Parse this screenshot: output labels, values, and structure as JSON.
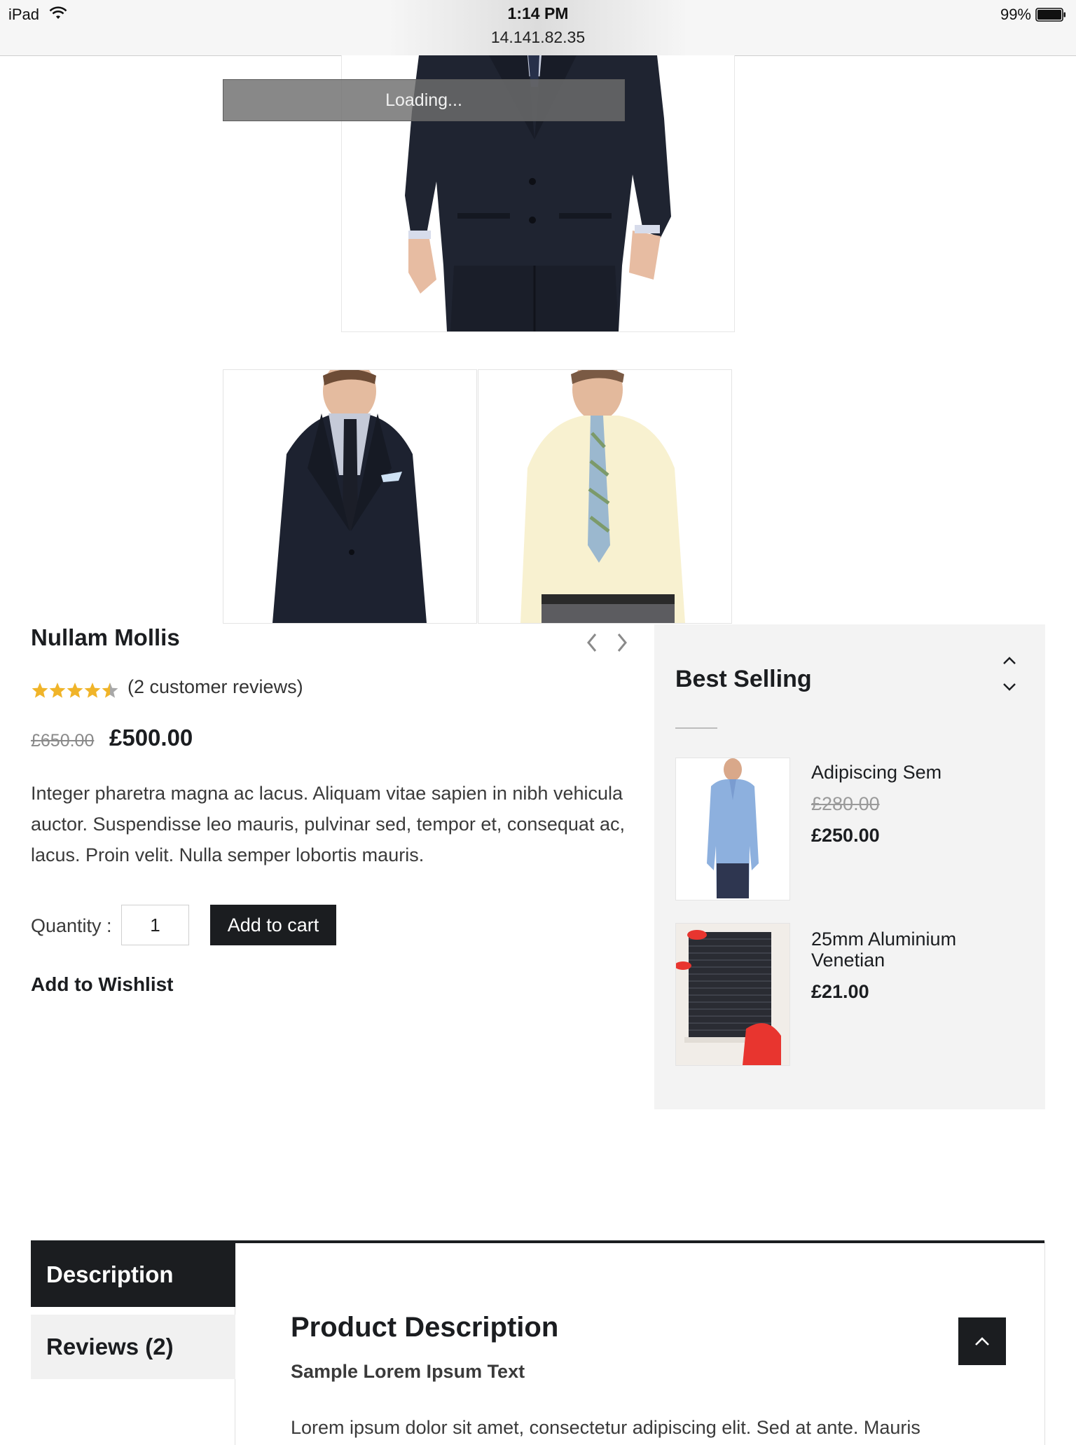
{
  "status_bar": {
    "device": "iPad",
    "time": "1:14 PM",
    "url": "14.141.82.35",
    "battery": "99%"
  },
  "product": {
    "loading_text": "Loading...",
    "title": "Nullam Mollis",
    "rating": 4.5,
    "rating_max": 5,
    "review_count_text": "(2 customer reviews)",
    "old_price": "£650.00",
    "price": "£500.00",
    "description": "Integer pharetra magna ac lacus. Aliquam vitae sapien in nibh vehicula auctor. Suspendisse leo mauris, pulvinar sed, tempor et, consequat ac, lacus. Proin velit. Nulla semper lobortis mauris.",
    "quantity_label": "Quantity :",
    "quantity_value": "1",
    "add_to_cart_label": "Add to cart",
    "wishlist_label": "Add to Wishlist"
  },
  "best_selling": {
    "title": "Best Selling",
    "items": [
      {
        "name": "Adipiscing Sem",
        "old_price": "£280.00",
        "price": "£250.00",
        "image": "blue-shirt-man"
      },
      {
        "name": "25mm Aluminium Venetian",
        "old_price": "",
        "price": "£21.00",
        "image": "venetian-blind-room"
      }
    ]
  },
  "tabs": {
    "items": [
      {
        "label": "Description",
        "active": true
      },
      {
        "label": "Reviews (2)",
        "active": false
      }
    ],
    "panel_title": "Product Description",
    "panel_subtitle": "Sample Lorem Ipsum Text",
    "panel_body": "Lorem ipsum dolor sit amet, consectetur adipiscing elit. Sed at ante. Mauris"
  },
  "colors": {
    "dark": "#1b1d20",
    "star": "#f0b429",
    "sidebar_bg": "#f3f3f3"
  }
}
